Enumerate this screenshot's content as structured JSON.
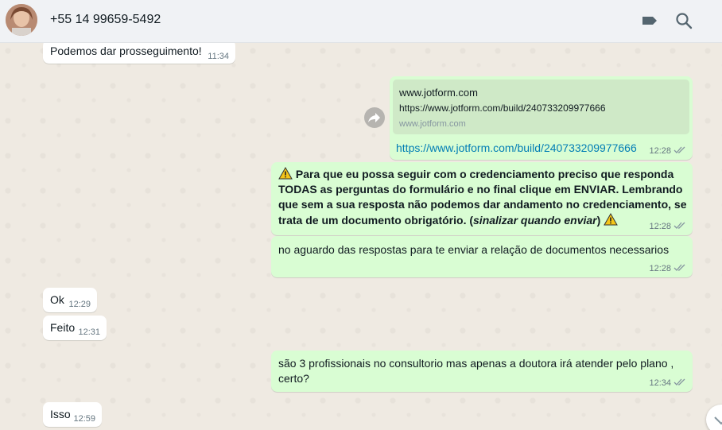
{
  "header": {
    "contact_name": "+55 14 99659-5492",
    "icons": [
      "avatar-photo",
      "label-icon",
      "search-icon"
    ]
  },
  "messages": [
    {
      "direction": "incoming",
      "text": "Podemos dar prosseguimento!",
      "time": "11:34"
    },
    {
      "direction": "outgoing",
      "link_preview": {
        "title": "www.jotform.com",
        "url": "https://www.jotform.com/build/240733209977666",
        "domain": "www.jotform.com"
      },
      "text": "https://www.jotform.com/build/240733209977666",
      "time": "12:28",
      "status": "read"
    },
    {
      "direction": "outgoing",
      "lines": [
        "Para que eu possa seguir com o credenciamento preciso que responda",
        "TODAS as perguntas do formulário e no final clique em ENVIAR. Lembrando",
        "que sem a sua resposta não podemos dar andamento no credenciamento, se",
        "trata de um documento obrigatório. (",
        "sinalizar quando enviar",
        ")"
      ],
      "time": "12:28",
      "status": "read"
    },
    {
      "direction": "outgoing",
      "text": "no aguardo das respostas para te enviar a relação de documentos necessarios",
      "time": "12:28",
      "status": "read"
    },
    {
      "direction": "incoming",
      "text": "Ok",
      "time": "12:29"
    },
    {
      "direction": "incoming",
      "text": "Feito",
      "time": "12:31"
    },
    {
      "direction": "outgoing",
      "lines": [
        "são 3 profissionais no consultorio mas apenas a doutora irá atender pelo plano ,",
        "certo?"
      ],
      "time": "12:34",
      "status": "read"
    },
    {
      "direction": "incoming",
      "text": "Isso",
      "time": "12:59"
    }
  ],
  "colors": {
    "incoming_bg": "#ffffff",
    "outgoing_bg": "#d9fdd3",
    "link": "#027eb5",
    "tick": "#8696a0",
    "header_bg": "#f0f2f5",
    "chat_bg": "#efeae2"
  }
}
